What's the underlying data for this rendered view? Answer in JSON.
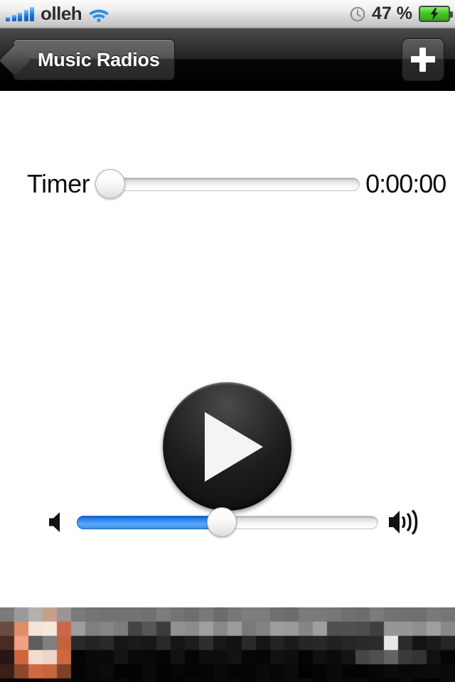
{
  "status_bar": {
    "carrier": "olleh",
    "signal_bars": 5,
    "signal_icon": "signal-bars-icon",
    "wifi_icon": "wifi-icon",
    "alarm_icon": "alarm-clock-icon",
    "battery_percent": "47 %",
    "battery_icon": "battery-charging-icon",
    "battery_color": "#43c722",
    "charging": true
  },
  "nav_bar": {
    "back_label": "Music Radios",
    "back_icon": "back-chevron-icon",
    "add_label": "+",
    "add_icon": "plus-icon"
  },
  "player": {
    "timer_label": "Timer",
    "timer_value": "0:00:00",
    "timer_slider": {
      "value": 0,
      "min": 0,
      "max": 100,
      "knob_icon": "slider-knob-icon"
    },
    "play_button": {
      "label": "Play",
      "icon": "play-triangle-icon",
      "state": "paused"
    },
    "volume": {
      "value": 48,
      "min": 0,
      "max": 100,
      "low_icon": "speaker-low-icon",
      "high_icon": "speaker-high-icon",
      "fill_color": "#3a8ef0",
      "knob_icon": "slider-knob-icon"
    }
  },
  "ad_banner": {
    "label": "advertisement-banner",
    "content": "pixelated",
    "block_size": 20,
    "thumbnail_accent": "#d2714f"
  }
}
